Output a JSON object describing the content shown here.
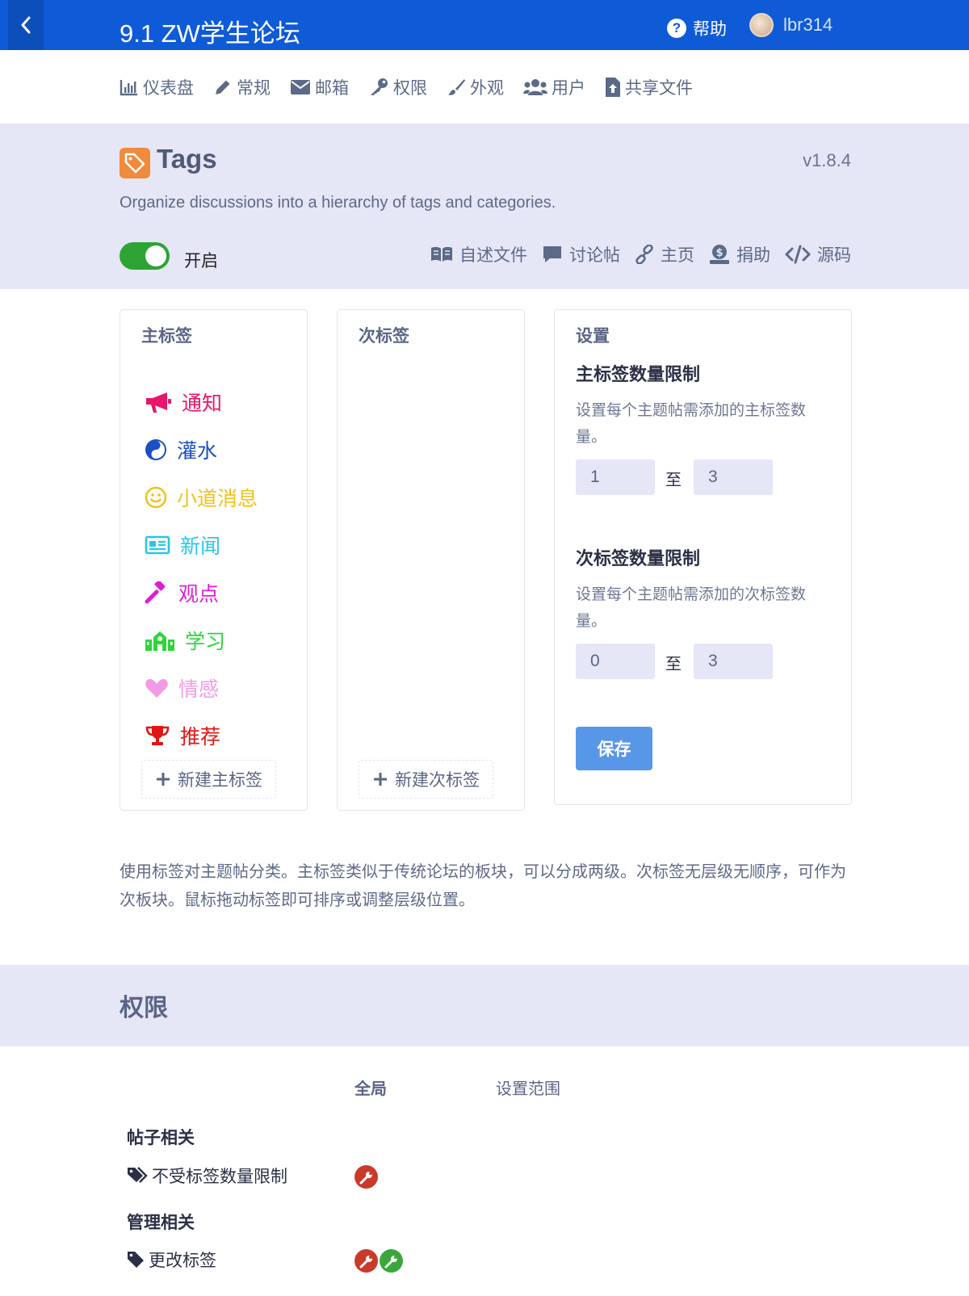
{
  "header": {
    "forum_title": "9.1 ZW学生论坛",
    "help_label": "帮助",
    "username": "lbr314"
  },
  "nav": {
    "items": [
      {
        "label": "仪表盘",
        "icon": "bar-chart-icon"
      },
      {
        "label": "常规",
        "icon": "pencil-icon"
      },
      {
        "label": "邮箱",
        "icon": "envelope-icon"
      },
      {
        "label": "权限",
        "icon": "key-icon"
      },
      {
        "label": "外观",
        "icon": "paintbrush-icon"
      },
      {
        "label": "用户",
        "icon": "users-icon"
      },
      {
        "label": "共享文件",
        "icon": "file-upload-icon"
      }
    ]
  },
  "extension": {
    "name": "Tags",
    "version": "v1.8.4",
    "description": "Organize discussions into a hierarchy of tags and categories.",
    "enabled_label": "开启",
    "links": [
      {
        "label": "自述文件",
        "icon": "book-icon"
      },
      {
        "label": "讨论帖",
        "icon": "comment-icon"
      },
      {
        "label": "主页",
        "icon": "link-icon"
      },
      {
        "label": "捐助",
        "icon": "donate-icon"
      },
      {
        "label": "源码",
        "icon": "code-icon"
      }
    ]
  },
  "primary_tags": {
    "heading": "主标签",
    "tags": [
      {
        "label": "通知",
        "color": "#e8156a",
        "icon": "bullhorn-icon"
      },
      {
        "label": "灌水",
        "color": "#1a50c2",
        "icon": "yin-yang-icon"
      },
      {
        "label": "小道消息",
        "color": "#f0c21a",
        "icon": "smile-icon"
      },
      {
        "label": "新闻",
        "color": "#27c7e8",
        "icon": "newspaper-icon"
      },
      {
        "label": "观点",
        "color": "#e01cd4",
        "icon": "gavel-icon"
      },
      {
        "label": "学习",
        "color": "#2cd63a",
        "icon": "school-icon"
      },
      {
        "label": "情感",
        "color": "#f29be6",
        "icon": "heart-icon"
      },
      {
        "label": "推荐",
        "color": "#e21414",
        "icon": "trophy-icon"
      }
    ],
    "new_label": "新建主标签"
  },
  "secondary_tags": {
    "heading": "次标签",
    "new_label": "新建次标签"
  },
  "settings": {
    "heading": "设置",
    "primary_limit": {
      "title": "主标签数量限制",
      "description": "设置每个主题帖需添加的主标签数量。",
      "min": "1",
      "max": "3",
      "to": "至"
    },
    "secondary_limit": {
      "title": "次标签数量限制",
      "description": "设置每个主题帖需添加的次标签数量。",
      "min": "0",
      "max": "3",
      "to": "至"
    },
    "save_label": "保存"
  },
  "help_text": "使用标签对主题帖分类。主标签类似于传统论坛的板块，可以分成两级。次标签无层级无顺序，可作为次板块。鼠标拖动标签即可排序或调整层级位置。",
  "permissions": {
    "title": "权限",
    "columns": {
      "global": "全局",
      "scope": "设置范围"
    },
    "groups": [
      {
        "label": "帖子相关",
        "items": [
          {
            "label": "不受标签数量限制",
            "icon": "tags-icon"
          }
        ]
      },
      {
        "label": "管理相关",
        "items": [
          {
            "label": "更改标签",
            "icon": "tag-icon"
          }
        ]
      }
    ]
  }
}
